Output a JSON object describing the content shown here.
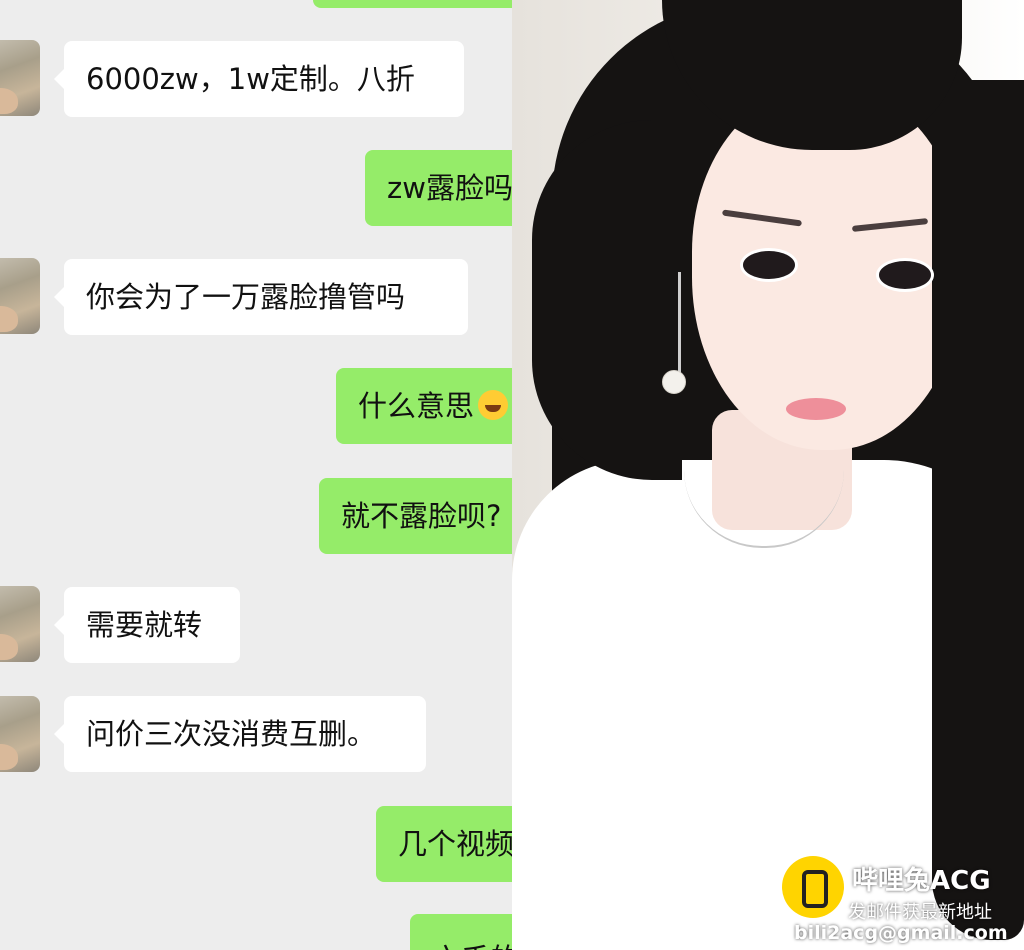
{
  "chat": {
    "messages": [
      {
        "side": "left",
        "text": "6000zw，1w定制。八折"
      },
      {
        "side": "right",
        "text": "zw露脸吗"
      },
      {
        "side": "left",
        "text": "你会为了一万露脸撸管吗"
      },
      {
        "side": "right",
        "text": "什么意思",
        "emoji": "tears-of-joy-emoji"
      },
      {
        "side": "right",
        "text": "就不露脸呗?"
      },
      {
        "side": "left",
        "text": "需要就转"
      },
      {
        "side": "left",
        "text": "问价三次没消费互删。"
      },
      {
        "side": "right",
        "text": "几个视频"
      },
      {
        "side": "right",
        "text": "六千的"
      }
    ]
  },
  "watermark": {
    "title": "哔哩兔ACG",
    "subtitle": "发邮件获最新地址",
    "email": "bili2acg@gmail.com",
    "logo": "bili-rabbit-logo"
  },
  "photo": {
    "description_icon": "selfie-photo"
  },
  "colors": {
    "chat_bg": "#ededed",
    "bubble_left": "#ffffff",
    "bubble_right": "#95ec69",
    "watermark_logo": "#ffd400"
  }
}
